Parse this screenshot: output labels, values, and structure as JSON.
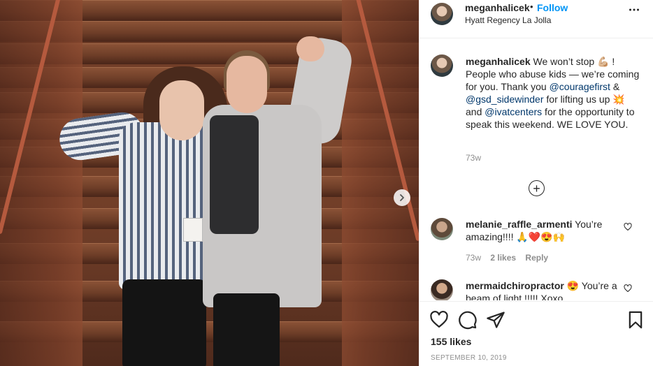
{
  "post": {
    "author": "meganhalicek",
    "follow_dot": "•",
    "follow_label": "Follow",
    "location": "Hyatt Regency La Jolla",
    "more_icon": "more-horizontal-icon"
  },
  "caption": {
    "username": "meganhalicek",
    "text_1": " We won’t stop 💪🏼 ! People who abuse kids — we’re coming for you. Thank you ",
    "mention_1": "@couragefirst",
    "text_2": " & ",
    "mention_2": "@gsd_sidewinder",
    "text_3": " for lifting us up 💥and ",
    "mention_3": "@ivatcenters",
    "text_4": " for the opportunity to speak this weekend. WE LOVE YOU.",
    "time": "73w"
  },
  "load_more_label": "+",
  "comments": [
    {
      "username": "melanie_raffle_armenti",
      "text": " You’re amazing!!!! 🙏❤️😍🙌",
      "time": "73w",
      "likes": "2 likes",
      "reply": "Reply"
    },
    {
      "username": "mermaidchiropractor",
      "text": " 😍 You’re a beam of light !!!!! Xoxo"
    }
  ],
  "actions": {
    "likes_count": "155 likes",
    "date": "SEPTEMBER 10, 2019"
  },
  "colors": {
    "accent": "#0095f6",
    "mention": "#00376b",
    "muted": "#8e8e8e"
  }
}
